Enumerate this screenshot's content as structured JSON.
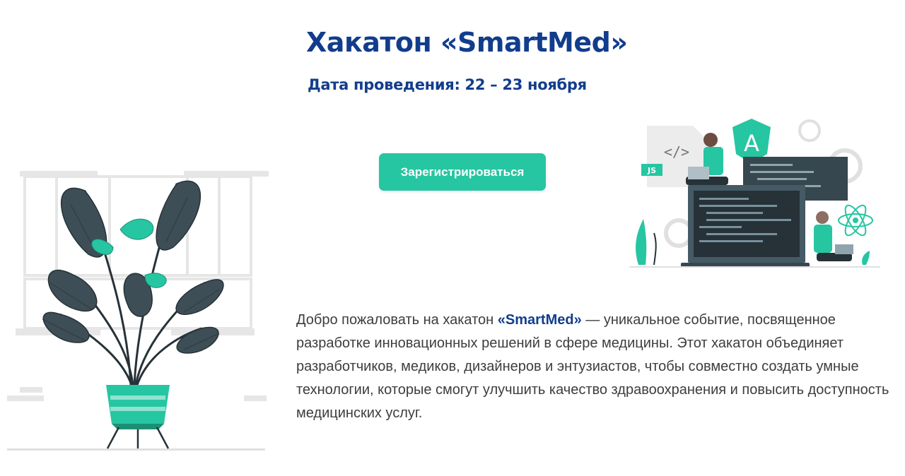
{
  "event": {
    "title": "Хакатон «SmartMed»",
    "date_line": "Дата проведения: 22 – 23 ноября",
    "register_label": "Зарегистрироваться"
  },
  "intro": {
    "before": "Добро пожаловать на хакатон ",
    "brand": "«SmartMed»",
    "after": " — уникальное событие, посвященное разработке инновационных решений в сфере медицины. Этот хакатон объединяет разработчиков, медиков, дизайнеров и энтузиастов, чтобы совместно создать умные технологии, которые смогут улучшить качество здравоохранения и повысить доступность медицинских услуг."
  },
  "illustration": {
    "js_badge": "JS",
    "code_symbol": "</>",
    "framework_letter": "A"
  },
  "colors": {
    "brand_blue": "#123d8c",
    "accent_green": "#26c6a2",
    "leaf_dark": "#37474f",
    "text_gray": "#3d3d3d"
  },
  "icons": [
    "plant-illustration",
    "developers-illustration",
    "react-atom-icon",
    "gear-icon",
    "angular-icon",
    "code-file-icon"
  ]
}
